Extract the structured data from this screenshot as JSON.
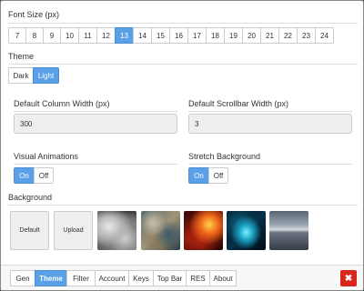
{
  "font_size": {
    "label": "Font Size (px)",
    "options": [
      "7",
      "8",
      "9",
      "10",
      "11",
      "12",
      "13",
      "14",
      "15",
      "16",
      "17",
      "18",
      "19",
      "20",
      "21",
      "22",
      "23",
      "24"
    ],
    "selected": "13"
  },
  "theme": {
    "label": "Theme",
    "options": [
      "Dark",
      "Light"
    ],
    "selected": "Light"
  },
  "column_width": {
    "label": "Default Column Width (px)",
    "value": "300"
  },
  "scrollbar_width": {
    "label": "Default Scrollbar Width (px)",
    "value": "3"
  },
  "visual_animations": {
    "label": "Visual Animations",
    "on": "On",
    "off": "Off",
    "selected": "On"
  },
  "stretch_background": {
    "label": "Stretch Background",
    "on": "On",
    "off": "Off",
    "selected": "On"
  },
  "background": {
    "label": "Background",
    "default_label": "Default",
    "upload_label": "Upload",
    "thumbnails": [
      "clouds-thumbnail",
      "aerial-terrain-thumbnail",
      "fire-thumbnail",
      "cyan-smoke-thumbnail",
      "stormy-sea-thumbnail"
    ]
  },
  "tabs": [
    "Gen",
    "Theme",
    "Filter",
    "Account",
    "Keys",
    "Top Bar",
    "RES",
    "About"
  ],
  "active_tab": "Theme",
  "close_icon": "✖",
  "colors": {
    "accent": "#5aa0e6",
    "close": "#d9261c"
  }
}
